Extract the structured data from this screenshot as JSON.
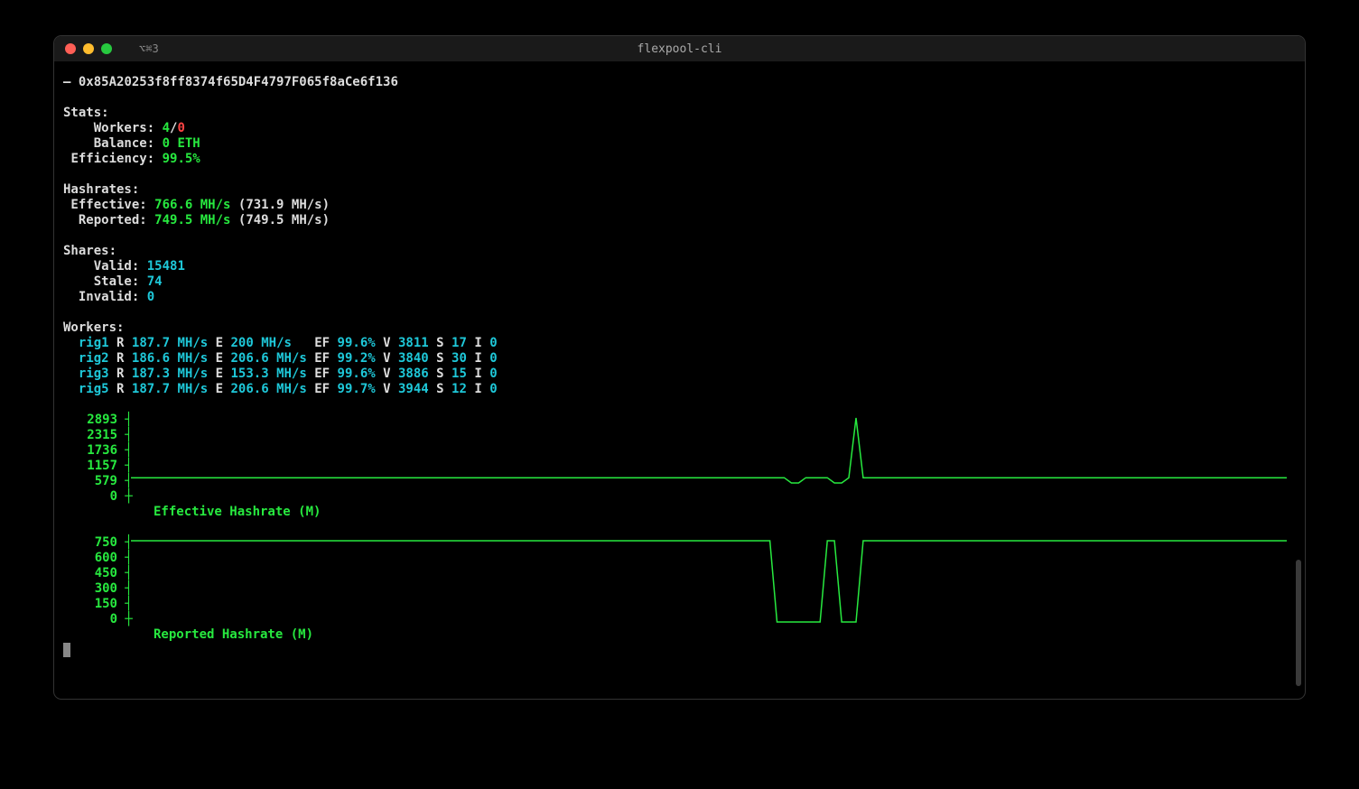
{
  "window": {
    "tab_label": "⌥⌘3",
    "title": "flexpool-cli"
  },
  "marker": "–",
  "address": "0x85A20253f8ff8374f65D4F4797F065f8aCe6f136",
  "stats": {
    "header": "Stats:",
    "workers_label": "  Workers:",
    "workers_online": "4",
    "workers_sep": "/",
    "workers_offline": "0",
    "balance_label": "  Balance:",
    "balance_value": "0 ETH",
    "efficiency_label": "Efficiency:",
    "efficiency_value": "99.5%"
  },
  "hashrates": {
    "header": "Hashrates:",
    "effective_label": " Effective:",
    "effective_value": "766.6 MH/s",
    "effective_paren": "(731.9 MH/s)",
    "reported_label": "  Reported:",
    "reported_value": "749.5 MH/s",
    "reported_paren": "(749.5 MH/s)"
  },
  "shares": {
    "header": "Shares:",
    "valid_label": "  Valid:",
    "valid_value": "15481",
    "stale_label": "  Stale:",
    "stale_value": "74",
    "invalid_label": "Invalid:",
    "invalid_value": "0"
  },
  "workers": {
    "header": "Workers:",
    "rows": [
      {
        "name": "rig1",
        "r": "187.7 MH/s",
        "e": "200 MH/s  ",
        "ef": "99.6%",
        "v": "3811",
        "s": "17",
        "i": "0"
      },
      {
        "name": "rig2",
        "r": "186.6 MH/s",
        "e": "206.6 MH/s",
        "ef": "99.2%",
        "v": "3840",
        "s": "30",
        "i": "0"
      },
      {
        "name": "rig3",
        "r": "187.3 MH/s",
        "e": "153.3 MH/s",
        "ef": "99.6%",
        "v": "3886",
        "s": "15",
        "i": "0"
      },
      {
        "name": "rig5",
        "r": "187.7 MH/s",
        "e": "206.6 MH/s",
        "ef": "99.7%",
        "v": "3944",
        "s": "12",
        "i": "0"
      }
    ],
    "lbl_r": "R",
    "lbl_e": "E",
    "lbl_ef": "EF",
    "lbl_v": "V",
    "lbl_s": "S",
    "lbl_i": "I"
  },
  "chart_data": [
    {
      "type": "line",
      "title": "Effective Hashrate (M)",
      "ylim": [
        0,
        2893
      ],
      "y_ticks": [
        "2893",
        "2315",
        "1736",
        "1157",
        "579",
        "0"
      ],
      "values": [
        766,
        766,
        766,
        766,
        766,
        766,
        766,
        766,
        766,
        766,
        766,
        766,
        766,
        766,
        766,
        766,
        766,
        766,
        766,
        766,
        766,
        766,
        766,
        766,
        766,
        766,
        766,
        766,
        766,
        766,
        766,
        766,
        766,
        766,
        766,
        766,
        766,
        766,
        766,
        766,
        766,
        766,
        766,
        766,
        766,
        766,
        766,
        766,
        766,
        766,
        766,
        766,
        766,
        766,
        766,
        766,
        766,
        766,
        766,
        766,
        766,
        766,
        766,
        766,
        766,
        766,
        766,
        766,
        766,
        766,
        766,
        766,
        766,
        766,
        766,
        766,
        766,
        766,
        766,
        766,
        766,
        766,
        766,
        766,
        766,
        766,
        766,
        766,
        766,
        766,
        766,
        766,
        579,
        579,
        766,
        766,
        766,
        766,
        579,
        579,
        766,
        2893,
        766,
        766,
        766,
        766,
        766,
        766,
        766,
        766,
        766,
        766,
        766,
        766,
        766,
        766,
        766,
        766,
        766,
        766,
        766,
        766,
        766,
        766,
        766,
        766,
        766,
        766,
        766,
        766,
        766,
        766,
        766,
        766,
        766,
        766,
        766,
        766,
        766,
        766,
        766,
        766,
        766,
        766,
        766,
        766,
        766,
        766,
        766,
        766,
        766,
        766,
        766,
        766,
        766,
        766,
        766,
        766,
        766,
        766,
        766,
        766
      ]
    },
    {
      "type": "line",
      "title": "Reported Hashrate (M)",
      "ylim": [
        0,
        750
      ],
      "y_ticks": [
        "750",
        "600",
        "450",
        "300",
        "150",
        "0"
      ],
      "values": [
        750,
        750,
        750,
        750,
        750,
        750,
        750,
        750,
        750,
        750,
        750,
        750,
        750,
        750,
        750,
        750,
        750,
        750,
        750,
        750,
        750,
        750,
        750,
        750,
        750,
        750,
        750,
        750,
        750,
        750,
        750,
        750,
        750,
        750,
        750,
        750,
        750,
        750,
        750,
        750,
        750,
        750,
        750,
        750,
        750,
        750,
        750,
        750,
        750,
        750,
        750,
        750,
        750,
        750,
        750,
        750,
        750,
        750,
        750,
        750,
        750,
        750,
        750,
        750,
        750,
        750,
        750,
        750,
        750,
        750,
        750,
        750,
        750,
        750,
        750,
        750,
        750,
        750,
        750,
        750,
        750,
        750,
        750,
        750,
        750,
        750,
        750,
        750,
        750,
        750,
        0,
        0,
        0,
        0,
        0,
        0,
        0,
        750,
        750,
        0,
        0,
        0,
        750,
        750,
        750,
        750,
        750,
        750,
        750,
        750,
        750,
        750,
        750,
        750,
        750,
        750,
        750,
        750,
        750,
        750,
        750,
        750,
        750,
        750,
        750,
        750,
        750,
        750,
        750,
        750,
        750,
        750,
        750,
        750,
        750,
        750,
        750,
        750,
        750,
        750,
        750,
        750,
        750,
        750,
        750,
        750,
        750,
        750,
        750,
        750,
        750,
        750,
        750,
        750,
        750,
        750,
        750,
        750,
        750,
        750,
        750,
        750
      ]
    }
  ]
}
